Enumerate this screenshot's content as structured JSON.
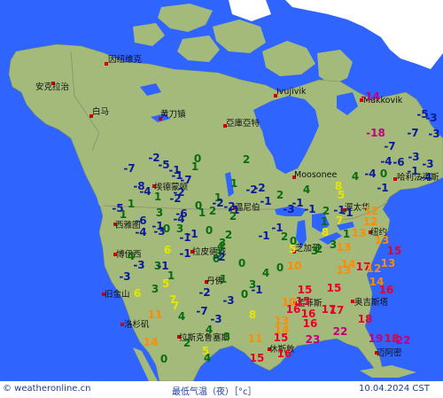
{
  "footer": {
    "source": "© weatheronline.cn",
    "title": "最低气温（夜）［°c］",
    "date": "10.04.2024 CST"
  },
  "colors": {
    "ocean": "#2f64ff",
    "land": "#a3ba7a",
    "ice": "#ffffff",
    "city_dot": "#d10000",
    "scale": {
      "le_-10": "#c0007a",
      "-9_to_-1": "#0a1a9b",
      "0_to_4": "#0b6b12",
      "5_to_9": "#e6e600",
      "10_to_14": "#ff8c00",
      "15_to_18": "#e8002c",
      "ge_19": "#c4007e"
    }
  },
  "cities": [
    {
      "id": "anchorage",
      "name": "安克拉治"
    },
    {
      "id": "whitehorse",
      "name": "白马"
    },
    {
      "id": "inuvik",
      "name": "因纽维克"
    },
    {
      "id": "yellowknife",
      "name": "黄刀镇"
    },
    {
      "id": "iqaluit",
      "name": "亞庫亞特"
    },
    {
      "id": "ivujivik",
      "name": "Ivujivik"
    },
    {
      "id": "makkovik",
      "name": "Makkovik"
    },
    {
      "id": "moosonee",
      "name": "Moosonee"
    },
    {
      "id": "halifax",
      "name": "哈利法克斯"
    },
    {
      "id": "edmonton",
      "name": "埃德蒙顿"
    },
    {
      "id": "winnipeg",
      "name": "温尼伯"
    },
    {
      "id": "ottawa",
      "name": "渥太华"
    },
    {
      "id": "seattle",
      "name": "西雅图"
    },
    {
      "id": "boise",
      "name": "博伊西"
    },
    {
      "id": "rapidcity",
      "name": "拉皮德城"
    },
    {
      "id": "chicago",
      "name": "芝加哥"
    },
    {
      "id": "newyork",
      "name": "纽约"
    },
    {
      "id": "sanfrancisco",
      "name": "旧金山"
    },
    {
      "id": "denver",
      "name": "丹佛"
    },
    {
      "id": "losangeles",
      "name": "洛杉矶"
    },
    {
      "id": "stlouis",
      "name": "孟菲斯"
    },
    {
      "id": "orlando",
      "name": "奥吉斯塔"
    },
    {
      "id": "albuquerque",
      "name": "拉斯克鲁塞斯"
    },
    {
      "id": "houston",
      "name": "休斯敦"
    },
    {
      "id": "miami",
      "name": "迈阿密"
    }
  ],
  "temperatures": [
    {
      "v": -14
    },
    {
      "v": -5
    },
    {
      "v": -3
    },
    {
      "v": -18
    },
    {
      "v": -7
    },
    {
      "v": -3
    },
    {
      "v": -7
    },
    {
      "v": -6
    },
    {
      "v": -3
    },
    {
      "v": -1
    },
    {
      "v": -4
    },
    {
      "v": -3
    },
    {
      "v": -7
    },
    {
      "v": -5
    },
    {
      "v": -2
    },
    {
      "v": -8
    },
    {
      "v": -1
    },
    {
      "v": 1
    },
    {
      "v": 0
    },
    {
      "v": -1
    },
    {
      "v": -4
    },
    {
      "v": 1
    },
    {
      "v": -2
    },
    {
      "v": -7
    },
    {
      "v": -2
    },
    {
      "v": 1
    },
    {
      "v": -2
    },
    {
      "v": 1
    },
    {
      "v": -6
    },
    {
      "v": 0
    },
    {
      "v": -3
    },
    {
      "v": 0
    },
    {
      "v": 2
    },
    {
      "v": 2
    },
    {
      "v": -2
    },
    {
      "v": -1
    },
    {
      "v": 4
    },
    {
      "v": 5
    },
    {
      "v": -4
    },
    {
      "v": -4
    },
    {
      "v": 4
    },
    {
      "v": -1
    },
    {
      "v": -6
    },
    {
      "v": -4
    },
    {
      "v": 1
    },
    {
      "v": 3
    },
    {
      "v": 1
    },
    {
      "v": -2
    },
    {
      "v": 2
    },
    {
      "v": -2
    },
    {
      "v": -1
    },
    {
      "v": -1
    },
    {
      "v": -3
    },
    {
      "v": -1
    },
    {
      "v": 2
    },
    {
      "v": -1
    },
    {
      "v": -1
    },
    {
      "v": 2
    },
    {
      "v": 1
    },
    {
      "v": 8
    },
    {
      "v": 0
    },
    {
      "v": 12
    },
    {
      "v": -5
    },
    {
      "v": 1
    },
    {
      "v": -1
    },
    {
      "v": 2
    },
    {
      "v": -1
    },
    {
      "v": 0
    },
    {
      "v": 3
    },
    {
      "v": -4
    },
    {
      "v": -1
    },
    {
      "v": 3
    },
    {
      "v": -1
    },
    {
      "v": 2
    },
    {
      "v": 7
    },
    {
      "v": 1
    },
    {
      "v": 3
    },
    {
      "v": 0
    },
    {
      "v": 12
    },
    {
      "v": 4
    },
    {
      "v": 3
    },
    {
      "v": 0
    },
    {
      "v": 1
    },
    {
      "v": -3
    },
    {
      "v": -1
    },
    {
      "v": -2
    },
    {
      "v": -1
    },
    {
      "v": 5
    },
    {
      "v": 3
    },
    {
      "v": 0
    },
    {
      "v": 13
    },
    {
      "v": 13
    },
    {
      "v": -1
    },
    {
      "v": 1
    },
    {
      "v": 6
    },
    {
      "v": 3
    },
    {
      "v": -2
    },
    {
      "v": 0
    },
    {
      "v": 4
    },
    {
      "v": 2
    },
    {
      "v": 8
    },
    {
      "v": 13
    },
    {
      "v": 17
    },
    {
      "v": -3
    },
    {
      "v": 6
    },
    {
      "v": 5
    },
    {
      "v": 4
    },
    {
      "v": 10
    },
    {
      "v": 14
    },
    {
      "v": 12
    },
    {
      "v": 15
    },
    {
      "v": 13
    },
    {
      "v": 15
    },
    {
      "v": 3
    },
    {
      "v": 7
    },
    {
      "v": -3
    },
    {
      "v": 3
    },
    {
      "v": -1
    },
    {
      "v": 0
    },
    {
      "v": 16
    },
    {
      "v": 15
    },
    {
      "v": 13
    },
    {
      "v": 14
    },
    {
      "v": 16
    },
    {
      "v": 7
    },
    {
      "v": 4
    },
    {
      "v": -3
    },
    {
      "v": 8
    },
    {
      "v": 10
    },
    {
      "v": 15
    },
    {
      "v": 16
    },
    {
      "v": 17
    },
    {
      "v": 11
    },
    {
      "v": 4
    },
    {
      "v": -7
    },
    {
      "v": 14
    },
    {
      "v": 16
    },
    {
      "v": 17
    },
    {
      "v": 18
    },
    {
      "v": 14
    },
    {
      "v": 4
    },
    {
      "v": 3
    },
    {
      "v": 11
    },
    {
      "v": 15
    },
    {
      "v": 16
    },
    {
      "v": 23
    },
    {
      "v": 22
    },
    {
      "v": 19
    },
    {
      "v": 22
    },
    {
      "v": 0
    },
    {
      "v": 2
    },
    {
      "v": 5
    },
    {
      "v": 15
    },
    {
      "v": 13
    },
    {
      "v": 18
    }
  ]
}
